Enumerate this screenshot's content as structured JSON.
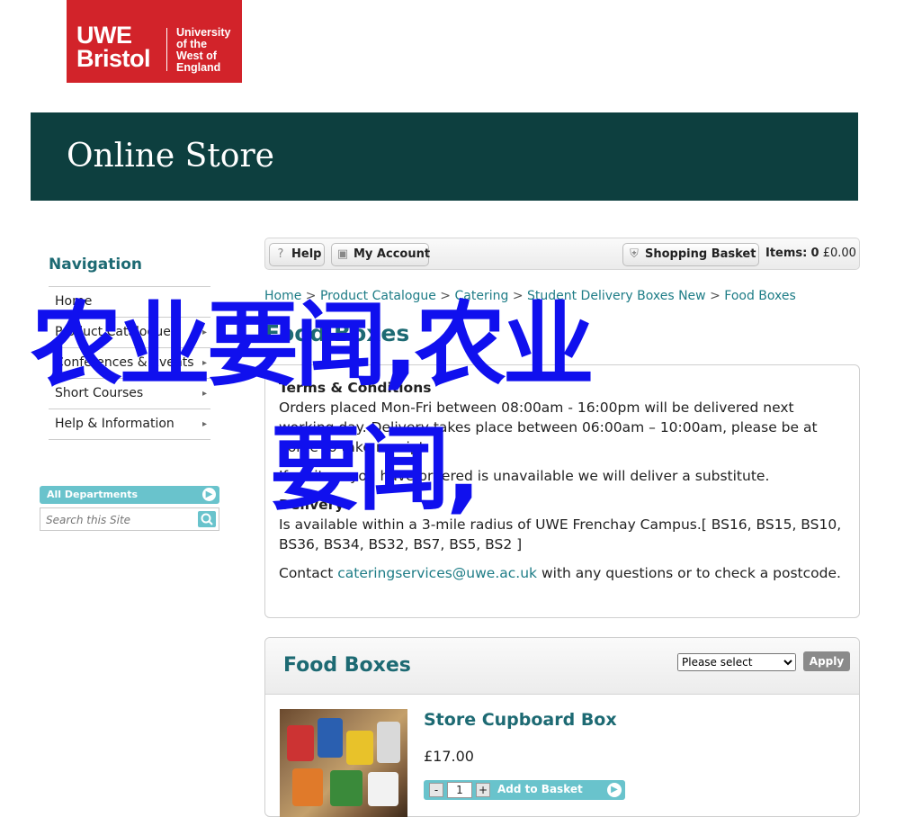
{
  "logo": {
    "line1": "UWE",
    "line2": "Bristol",
    "uni1": "University",
    "uni2": "of the",
    "uni3": "West of",
    "uni4": "England"
  },
  "banner": {
    "title": "Online Store"
  },
  "nav": {
    "heading": "Navigation",
    "items": [
      {
        "label": "Home"
      },
      {
        "label": "Product Catalogue"
      },
      {
        "label": "Conferences & Events"
      },
      {
        "label": "Short Courses"
      },
      {
        "label": "Help & Information"
      }
    ]
  },
  "departments": {
    "label": "All Departments",
    "search_placeholder": "Search this Site"
  },
  "toolbar": {
    "help": "Help",
    "account": "My Account",
    "basket": "Shopping Basket",
    "items_label": "Items:",
    "items_count": "0",
    "total": "£0.00"
  },
  "breadcrumb": {
    "items": [
      "Home",
      "Product Catalogue",
      "Catering",
      "Student Delivery Boxes New",
      "Food Boxes"
    ],
    "separator": ">"
  },
  "page_title": "Food Boxes",
  "terms": {
    "heading": "Terms & Conditions",
    "p1": "Orders placed Mon-Fri between 08:00am - 16:00pm will be delivered next working day. Delivery takes place between 06:00am – 10:00am, please be at home to take receipt.",
    "p2": "If an item you have ordered is unavailable we will deliver a substitute.",
    "delivery_heading": "Delivery",
    "p3": "Is available within a 3-mile radius of UWE Frenchay Campus.[ BS16, BS15, BS10, BS36, BS34, BS32, BS7, BS5, BS2 ]",
    "p4_pre": "Contact ",
    "p4_email": "cateringservices@uwe.ac.uk",
    "p4_post": " with any questions or to check a postcode."
  },
  "food_boxes": {
    "title": "Food Boxes",
    "select_value": "Please select",
    "apply": "Apply",
    "product": {
      "name": "Store Cupboard Box",
      "price": "£17.00",
      "qty": "1",
      "minus": "-",
      "plus": "+",
      "add_label": "Add to Basket"
    }
  },
  "overlay": {
    "line1": "农业要闻,农业",
    "line2": "要闻,"
  },
  "colors": {
    "brand_red": "#d2232a",
    "banner": "#0d3f3f",
    "accent": "#1d6a73",
    "teal": "#69c3cc",
    "overlay": "#1010ee"
  }
}
